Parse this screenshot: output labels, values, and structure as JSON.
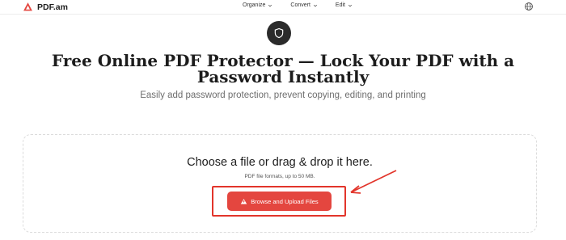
{
  "brand": {
    "name": "PDF.am",
    "logo_icon": "pdf-am-logo-icon",
    "accent": "#e4463f"
  },
  "nav": {
    "items": [
      {
        "label": "Organize",
        "icon": "chevron-down-icon"
      },
      {
        "label": "Convert",
        "icon": "chevron-down-icon"
      },
      {
        "label": "Edit",
        "icon": "chevron-down-icon"
      }
    ],
    "language_icon": "globe-icon"
  },
  "hero": {
    "icon": "shield-icon",
    "title": "Free Online PDF Protector — Lock Your PDF with a Password Instantly",
    "subtitle": "Easily add password protection, prevent copying, editing, and printing"
  },
  "upload": {
    "title": "Choose a file or drag & drop it here.",
    "hint": "PDF file formats, up to 50 MB.",
    "button_label": "Browse and Upload Files",
    "button_icon": "upload-icon"
  },
  "annotation": {
    "color": "#e2352b",
    "shape": "highlight-box-with-arrow"
  }
}
